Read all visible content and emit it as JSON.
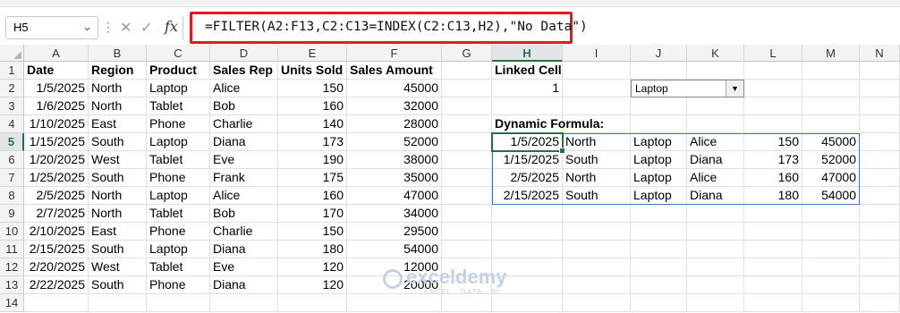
{
  "namebox": {
    "value": "H5"
  },
  "formula": "=FILTER(A2:F13,C2:C13=INDEX(C2:C13,H2),\"No Data\")",
  "fx": "fx",
  "columns": [
    "A",
    "B",
    "C",
    "D",
    "E",
    "F",
    "G",
    "H",
    "I",
    "J",
    "K",
    "L",
    "M",
    "N"
  ],
  "selected_column": "H",
  "selected_row": "5",
  "rows": [
    "1",
    "2",
    "3",
    "4",
    "5",
    "6",
    "7",
    "8",
    "9",
    "10",
    "11",
    "12",
    "13",
    "14"
  ],
  "table": {
    "headers": [
      "Date",
      "Region",
      "Product",
      "Sales Rep",
      "Units Sold",
      "Sales Amount"
    ],
    "records": [
      [
        "1/5/2025",
        "North",
        "Laptop",
        "Alice",
        "150",
        "45000"
      ],
      [
        "1/6/2025",
        "North",
        "Tablet",
        "Bob",
        "160",
        "32000"
      ],
      [
        "1/10/2025",
        "East",
        "Phone",
        "Charlie",
        "140",
        "28000"
      ],
      [
        "1/15/2025",
        "South",
        "Laptop",
        "Diana",
        "173",
        "52000"
      ],
      [
        "1/20/2025",
        "West",
        "Tablet",
        "Eve",
        "190",
        "38000"
      ],
      [
        "1/25/2025",
        "South",
        "Phone",
        "Frank",
        "175",
        "35000"
      ],
      [
        "2/5/2025",
        "North",
        "Laptop",
        "Alice",
        "160",
        "47000"
      ],
      [
        "2/7/2025",
        "North",
        "Tablet",
        "Bob",
        "170",
        "34000"
      ],
      [
        "2/10/2025",
        "East",
        "Phone",
        "Charlie",
        "150",
        "29500"
      ],
      [
        "2/15/2025",
        "South",
        "Laptop",
        "Diana",
        "180",
        "54000"
      ],
      [
        "2/20/2025",
        "West",
        "Tablet",
        "Eve",
        "120",
        "12000"
      ],
      [
        "2/22/2025",
        "South",
        "Phone",
        "Diana",
        "120",
        "20000"
      ]
    ]
  },
  "linked_cell": {
    "label": "Linked Cell",
    "value": "1"
  },
  "dropdown": {
    "selected": "Laptop"
  },
  "dynamic": {
    "label": "Dynamic Formula:",
    "rows": [
      [
        "1/5/2025",
        "North",
        "Laptop",
        "Alice",
        "150",
        "45000"
      ],
      [
        "1/15/2025",
        "South",
        "Laptop",
        "Diana",
        "173",
        "52000"
      ],
      [
        "2/5/2025",
        "North",
        "Laptop",
        "Alice",
        "160",
        "47000"
      ],
      [
        "2/15/2025",
        "South",
        "Laptop",
        "Diana",
        "180",
        "54000"
      ]
    ]
  },
  "watermark": {
    "name": "exceldemy",
    "tagline": "EXCEL · DATA · BI"
  }
}
